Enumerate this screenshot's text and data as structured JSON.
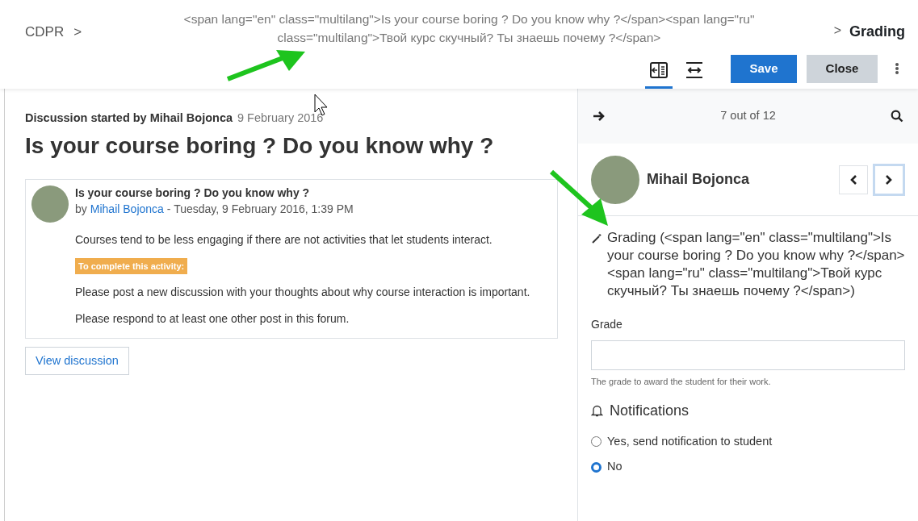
{
  "header": {
    "breadcrumb": "CDPR",
    "breadcrumb_separator": ">",
    "title": "<span lang=\"en\" class=\"multilang\">Is your course boring ? Do you know why ?</span><span lang=\"ru\" class=\"multilang\">Твой курс скучный? Ты знаешь почему ?</span>",
    "section_separator": ">",
    "section": "Grading",
    "view_toggles": [
      {
        "kind": "collapse-panel",
        "selected": true
      },
      {
        "kind": "expand-width",
        "selected": false
      }
    ],
    "buttons": [
      {
        "label": "Save",
        "kind": "primary"
      },
      {
        "label": "Close",
        "kind": "secondary"
      }
    ]
  },
  "discussion": {
    "started_by": "Discussion started by Mihail Bojonca",
    "date": "9 February 2016",
    "title": "Is your course boring ? Do you know why ?",
    "post": {
      "subject": "Is your course boring ? Do you know why ?",
      "by_prefix": "by",
      "author": "Mihail Bojonca",
      "when": "- Tuesday, 9 February 2016, 1:39 PM",
      "blocks": [
        {
          "kind": "paragraph",
          "text": "Courses tend to be less engaging if there are not activities that let students interact."
        },
        {
          "kind": "badge",
          "text": "To complete this activity:"
        },
        {
          "kind": "paragraph",
          "text": "Please post a new discussion with your thoughts about why course interaction is important."
        },
        {
          "kind": "paragraph",
          "text": "Please respond to at least one other post in this forum."
        }
      ]
    },
    "view_button": "View discussion"
  },
  "grader": {
    "counter": "7 out of 12",
    "user": "Mihail Bojonca",
    "heading": "Grading (<span lang=\"en\" class=\"multilang\">Is your course boring ? Do you know why ?</span><span lang=\"ru\" class=\"multilang\">Твой курс скучный? Ты знаешь почему ?</span>)",
    "grade_label": "Grade",
    "grade_help": "The grade to award the student for their work.",
    "notifications_heading": "Notifications",
    "options": [
      {
        "label": "Yes, send notification to student",
        "selected": false
      },
      {
        "label": "No",
        "selected": true
      }
    ]
  }
}
